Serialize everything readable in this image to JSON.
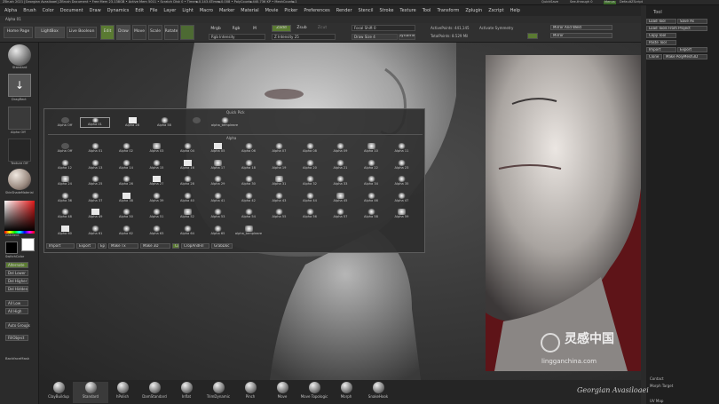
{
  "titlebar": {
    "text": "ZBrush 2021 [Georgian Avasiloaei]  ZBrush Document   • Free Mem 23.138GB • Active Mem 5011 • Scratch Disk 0 • Timer►0.143 ATime►0.008 • PolyCount►440.736 KP • MeshCount►1",
    "quicksave": "QuickSave",
    "seethrough": "See-through  0",
    "menus_label": "Menus",
    "script_label": "DefaultZScript"
  },
  "menu": [
    "Alpha",
    "Brush",
    "Color",
    "Document",
    "Draw",
    "Dynamics",
    "Edit",
    "File",
    "Layer",
    "Light",
    "Macro",
    "Marker",
    "Material",
    "Movie",
    "Picker",
    "Preferences",
    "Render",
    "Stencil",
    "Stroke",
    "Texture",
    "Tool",
    "Transform",
    "Zplugin",
    "Zscript",
    "Help"
  ],
  "subrow": {
    "active": "Alpha 01"
  },
  "shelf": {
    "home": "Home Page",
    "lightbox": "LightBox",
    "live_boolean": "Live Boolean",
    "edit": "Edit",
    "draw": "Draw",
    "move": "Move",
    "scale": "Scale",
    "rotate": "Rotate",
    "mrgb": "Mrgb",
    "rgb": "Rgb",
    "m": "M",
    "rgb_intensity": "Rgb Intensity",
    "zadd": "Zadd",
    "zsub": "Zsub",
    "zcut": "Zcut",
    "z_intensity": "Z Intensity 25",
    "focal_shift": "Focal Shift 0",
    "draw_size": "Draw Size 4",
    "dynamic": "Dynamic",
    "active_points": "ActivePoints: 441,145",
    "total_points": "TotalPoints: 8.529 Mil",
    "activate_symmetry": "Activate Symmetry",
    "mirror_weld": "Mirror And Weld",
    "mirror": "Mirror"
  },
  "tool_panel": {
    "title": "Tool",
    "load_tool": "Load Tool",
    "save_as": "Save As",
    "load_from_project": "Load Tools From Project",
    "copy_tool": "Copy Tool",
    "paste_tool": "Paste Tool",
    "import": "Import",
    "export": "Export",
    "clone": "Clone",
    "make_polymesh": "Make PolyMesh3D",
    "export2": "Export",
    "contact": "Contact",
    "morph_target": "Morph Target",
    "uv_map": "UV Map"
  },
  "left_tray": {
    "standard": "Standard",
    "dragrect": "DragRect",
    "alpha_off": "Alpha Off",
    "texture_off": "Texture Off",
    "material": "SkinShadeMaterial",
    "gradient": "Gradient",
    "switch_color": "SwitchColor",
    "alternate": "Alternate",
    "del_lower": "Del Lower",
    "del_higher": "Del Higher",
    "del_hidden": "Del Hidden",
    "all_low": "All Low",
    "all_high": "All High",
    "auto_groups": "Auto Groups",
    "fill_object": "FillObject",
    "backface_mask": "BackfaceMask"
  },
  "popup": {
    "quick_pick": "Quick Pick",
    "quick_items": [
      "Alpha Off",
      "Alpha 01",
      "Alpha 28",
      "Alpha 58",
      "",
      "alpha_templeare"
    ],
    "section": "Alpha",
    "alphas": [
      "Alpha Off",
      "Alpha 01",
      "Alpha 02",
      "Alpha 03",
      "Alpha 04",
      "Alpha 05",
      "Alpha 06",
      "Alpha 07",
      "Alpha 08",
      "Alpha 09",
      "Alpha 10",
      "Alpha 11",
      "Alpha 12",
      "Alpha 13",
      "Alpha 14",
      "Alpha 15",
      "Alpha 16",
      "Alpha 17",
      "Alpha 18",
      "Alpha 19",
      "Alpha 20",
      "Alpha 21",
      "Alpha 22",
      "Alpha 23",
      "Alpha 24",
      "Alpha 25",
      "Alpha 26",
      "Alpha 27",
      "Alpha 28",
      "Alpha 29",
      "Alpha 30",
      "Alpha 31",
      "Alpha 32",
      "Alpha 33",
      "Alpha 34",
      "Alpha 35",
      "Alpha 36",
      "Alpha 37",
      "Alpha 38",
      "Alpha 39",
      "Alpha 40",
      "Alpha 41",
      "Alpha 42",
      "Alpha 43",
      "Alpha 44",
      "Alpha 45",
      "Alpha 46",
      "Alpha 47",
      "Alpha 48",
      "Alpha 49",
      "Alpha 50",
      "Alpha 51",
      "Alpha 52",
      "Alpha 53",
      "Alpha 54",
      "Alpha 55",
      "Alpha 56",
      "Alpha 57",
      "Alpha 58",
      "Alpha 59",
      "Alpha 60",
      "Alpha 61",
      "Alpha 62",
      "Alpha 63",
      "Alpha 64",
      "Alpha 65",
      "alpha_templeare"
    ],
    "footer": [
      "Import",
      "Export",
      "Ep",
      "Make Tx",
      "Make 3D",
      "Cc",
      "CropAndFill",
      "GrabDoc"
    ]
  },
  "bottom_brushes": [
    "ClayBuildup",
    "Standard",
    "hPolish",
    "DamStandard",
    "Inflat",
    "TrimDynamic",
    "Pinch",
    "Move",
    "Move Topologic",
    "Morph",
    "SnakeHook"
  ],
  "watermark": {
    "brand": "灵感中国",
    "site": "lingganchina.com",
    "author": "Georgian Avasiloaei"
  },
  "colors": {
    "accent_green": "#5a7a32",
    "bg": "#2b2b2b",
    "color_picker_main": "#d22020"
  }
}
